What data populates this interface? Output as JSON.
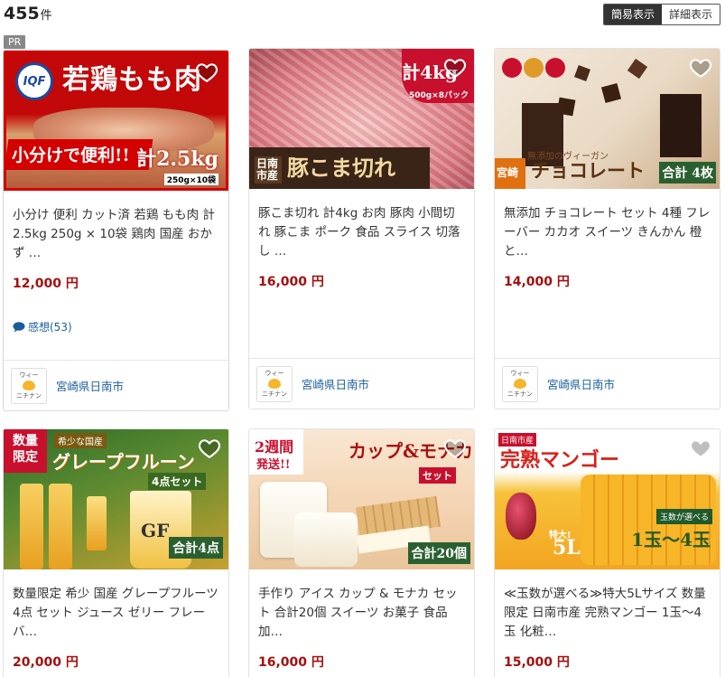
{
  "results": {
    "count": "455",
    "unit": "件"
  },
  "view_toggle": {
    "simple": "簡易表示",
    "detail": "詳細表示"
  },
  "pr_label": "PR",
  "products": [
    {
      "title": "小分け 便利 カット済 若鶏 もも肉 計2.5kg 250g × 10袋 鶏肉 国産 おかず …",
      "price": "12,000 円",
      "review": "感想(53)",
      "city": "宮崎県日南市",
      "img_text": {
        "a": "IQF",
        "b": "若鶏もも肉",
        "c": "小分けで便利!!",
        "d": "計2.5kg",
        "e": "250g×10袋"
      }
    },
    {
      "title": "豚こま切れ 計4kg お肉 豚肉 小間切れ 豚こま ポーク 食品 スライス 切落し …",
      "price": "16,000 円",
      "city": "宮崎県日南市",
      "img_text": {
        "a": "計4kg",
        "b": "500g×8パック",
        "c": "日南市産",
        "d": "豚こま切れ"
      }
    },
    {
      "title": "無添加 チョコレート セット 4種 フレーバー カカオ スイーツ きんかん 橙と…",
      "price": "14,000 円",
      "city": "宮崎県日南市",
      "img_text": {
        "a": "無添加のヴィーガン",
        "b": "チョコレート",
        "c": "宮崎",
        "d": "合計 4枚"
      }
    },
    {
      "title": "数量限定 希少 国産 グレープフルーツ 4点 セット ジュース ゼリー フレーバ…",
      "price": "20,000 円",
      "img_text": {
        "a": "数量限定",
        "b": "希少な国産",
        "c": "グレープフルーン",
        "d": "4点セット",
        "e": "合計4点",
        "f": "GF"
      }
    },
    {
      "title": "手作り アイス カップ & モナカ セット 合計20個 スイーツ お菓子 食品 加…",
      "price": "16,000 円",
      "img_text": {
        "a": "2週間",
        "b": "発送!!",
        "c": "カップ&モナカ",
        "d": "セット",
        "e": "合計20個"
      }
    },
    {
      "title": "≪玉数が選べる≫特大5Lサイズ 数量限定 日南市産 完熟マンゴー 1玉～4玉 化粧…",
      "price": "15,000 円",
      "img_text": {
        "a": "日南市産",
        "b": "完熟マンゴー",
        "c": "特大!",
        "d": "5L",
        "e": "玉数が選べる",
        "f": "1玉〜4玉"
      }
    }
  ],
  "logo": {
    "top": "ウィー",
    "bottom": "ニチナン"
  },
  "colors": {
    "price": "#a50e0e",
    "link": "#1a5d9c",
    "toggle_active": "#333333"
  }
}
